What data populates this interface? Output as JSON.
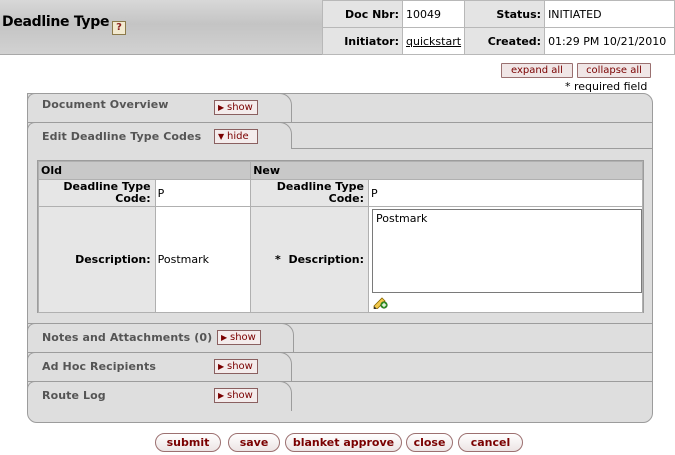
{
  "header": {
    "title": "Deadline Type",
    "help_glyph": "?",
    "doc_nbr_label": "Doc Nbr:",
    "doc_nbr_value": "10049",
    "status_label": "Status:",
    "status_value": "INITIATED",
    "initiator_label": "Initiator:",
    "initiator_value": "quickstart",
    "created_label": "Created:",
    "created_value": "01:29 PM 10/21/2010"
  },
  "toolbar": {
    "expand_all": "expand all",
    "collapse_all": "collapse all",
    "required_note": "* required field"
  },
  "panels": {
    "doc_overview": {
      "label": "Document Overview",
      "toggle": "show"
    },
    "edit": {
      "label": "Edit Deadline Type Codes",
      "toggle": "hide"
    },
    "notes": {
      "label": "Notes and Attachments (0)",
      "toggle": "show"
    },
    "adhoc": {
      "label": "Ad Hoc Recipients",
      "toggle": "show"
    },
    "route": {
      "label": "Route Log",
      "toggle": "show"
    }
  },
  "edit_table": {
    "old_header": "Old",
    "new_header": "New",
    "code_label_old": "Deadline Type Code:",
    "code_value_old": "P",
    "code_label_new": "Deadline Type Code:",
    "code_value_new": "P",
    "desc_label_old": "Description:",
    "desc_value_old": "Postmark",
    "desc_label_new": "*  Description:",
    "desc_value_new": "Postmark"
  },
  "actions": {
    "submit": "submit",
    "save": "save",
    "blanket_approve": "blanket approve",
    "close": "close",
    "cancel": "cancel"
  },
  "icons": {
    "help": "help-icon",
    "pencil": "pencil-edit-icon",
    "show_triangle": "triangle-right-icon",
    "hide_triangle": "triangle-down-icon"
  },
  "colors": {
    "button_text": "#7a0000",
    "panel_bg": "#dedede",
    "header_bg": "#c8c8c8"
  }
}
